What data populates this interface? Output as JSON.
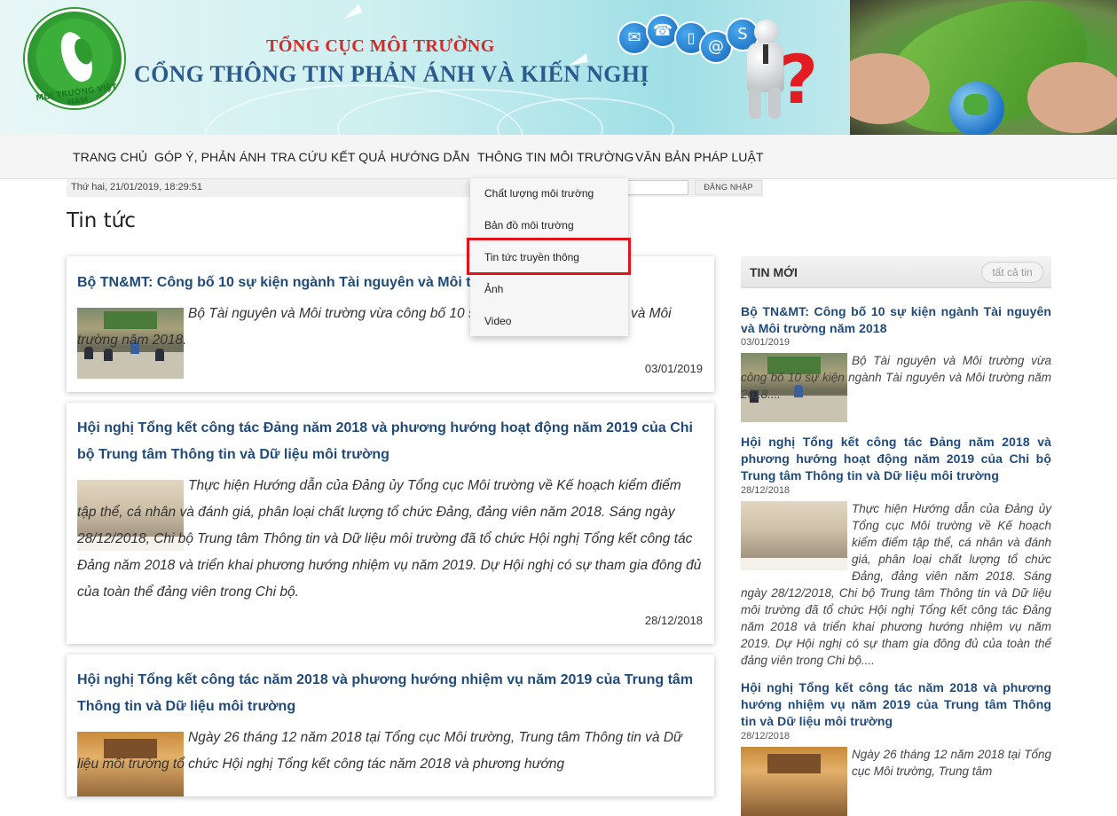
{
  "header": {
    "org_name": "TỔNG CỤC MÔI TRƯỜNG",
    "portal_name": "CỔNG THÔNG TIN PHẢN ÁNH VÀ KIẾN NGHỊ",
    "logo_text": "MÔI TRƯỜNG VIỆT NAM",
    "contact_icons": [
      "envelope-icon",
      "phone-icon",
      "mobile-icon",
      "at-icon",
      "skype-icon"
    ],
    "question_mark": "?"
  },
  "nav": {
    "items": [
      "TRANG CHỦ",
      "GÓP Ý, PHẢN ÁNH",
      "TRA CỨU KẾT QUẢ",
      "HƯỚNG DẪN",
      "THÔNG TIN MÔI TRƯỜNG",
      "VĂN BẢN PHÁP LUẬT"
    ]
  },
  "infobar": {
    "datetime": "Thứ hai, 21/01/2019, 18:29:51",
    "login_label": "ĐĂNG NHẬP"
  },
  "dropdown": {
    "items": [
      "Chất lượng môi trường",
      "Bản đồ môi trường",
      "Tin tức truyền thông",
      "Ảnh",
      "Video"
    ],
    "highlighted_index": 2
  },
  "page_title": "Tin tức",
  "articles": [
    {
      "title": "Bộ TN&MT: Công bố 10 sự kiện ngành Tài nguyên và Môi t",
      "desc": "Bộ Tài nguyên và Môi trường vừa công bố 10 sự kiện ngành Tài nguyên và Môi trường năm 2018.",
      "date": "03/01/2019"
    },
    {
      "title": "Hội nghị Tổng kết công tác Đảng năm 2018 và phương hướng hoạt động năm 2019 của Chi bộ Trung tâm Thông tin và Dữ liệu môi trường",
      "desc": "Thực hiện Hướng dẫn của Đảng ủy Tổng cục Môi trường về Kế hoạch kiểm điểm tập thể, cá nhân và đánh giá, phân loại chất lượng tổ chức Đảng, đảng viên năm 2018. Sáng ngày 28/12/2018, Chi bộ Trung tâm Thông tin và Dữ liệu môi trường đã tổ chức Hội nghị Tổng kết công tác Đảng năm 2018 và triển khai phương hướng nhiệm vụ năm 2019. Dự Hội nghị có sự tham gia đông đủ của toàn thể đảng viên trong Chi bộ.",
      "date": "28/12/2018"
    },
    {
      "title": "Hội nghị Tổng kết công tác năm 2018 và phương hướng nhiệm vụ năm 2019 của Trung tâm Thông tin và Dữ liệu môi trường",
      "desc": "Ngày 26 tháng 12 năm 2018 tại Tổng cục Môi trường, Trung tâm Thông tin và Dữ liệu môi trường tổ chức Hội nghị Tổng kết công tác năm 2018 và phương hướng"
    }
  ],
  "sidebar": {
    "heading": "TIN MỚI",
    "all_button": "tất cả tin",
    "items": [
      {
        "title": "Bộ TN&MT: Công bố 10 sự kiện ngành Tài nguyên và Môi trường năm 2018",
        "date": "03/01/2019",
        "desc": "Bộ Tài nguyên và Môi trường vừa công bố 10 sự kiện ngành Tài nguyên và Môi trường năm 2018...."
      },
      {
        "title": "Hội nghị Tổng kết công tác Đảng năm 2018 và phương hướng hoạt động năm 2019 của Chi bộ Trung tâm Thông tin và Dữ liệu môi trường",
        "date": "28/12/2018",
        "desc": "Thực hiện Hướng dẫn của Đảng ủy Tổng cục Môi trường về Kế hoạch kiểm điểm tập thể, cá nhân và đánh giá, phân loại chất lượng tổ chức Đảng, đảng viên năm 2018. Sáng ngày 28/12/2018, Chi bộ Trung tâm Thông tin và Dữ liệu môi trường đã tổ chức Hội nghị Tổng kết công tác Đảng năm 2018 và triển khai phương hướng nhiệm vụ năm 2019. Dự Hội nghị có sự tham gia đông đủ của toàn thể đảng viên trong Chi bộ...."
      },
      {
        "title": "Hội nghị Tổng kết công tác năm 2018 và phương hướng nhiệm vụ năm 2019 của Trung tâm Thông tin và Dữ liệu môi trường",
        "date": "28/12/2018",
        "desc": "Ngày 26 tháng 12 năm 2018 tại Tổng cục Môi trường, Trung tâm"
      }
    ]
  },
  "colors": {
    "title_red": "#d42a2a",
    "title_blue": "#2a5a8e",
    "link_blue": "#1f4a7a",
    "highlight_red": "#e1141d"
  }
}
